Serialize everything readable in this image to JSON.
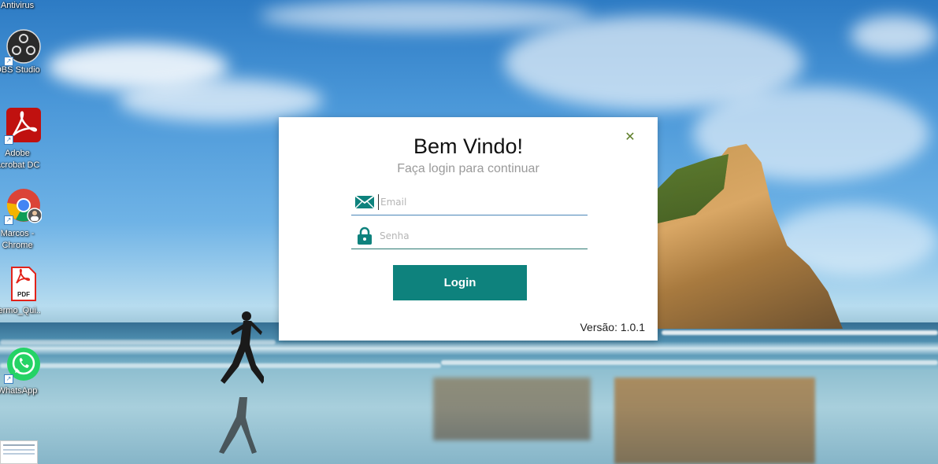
{
  "desktop": {
    "icons": [
      {
        "label": "Antivirus",
        "icon": "antivirus-icon"
      },
      {
        "label": "OBS Studio",
        "icon": "obs-studio-icon"
      },
      {
        "label": "Adobe Acrobat DC",
        "label_line1": "Adobe",
        "label_line2": "Acrobat DC",
        "icon": "adobe-acrobat-icon"
      },
      {
        "label": "Marcos - Chrome",
        "label_line1": "Marcos -",
        "label_line2": "Chrome",
        "icon": "chrome-icon"
      },
      {
        "label": "Termo_Qui...",
        "icon": "pdf-file-icon",
        "badge": "PDF"
      },
      {
        "label": "WhatsApp",
        "icon": "whatsapp-icon"
      }
    ]
  },
  "dialog": {
    "title": "Bem Vindo!",
    "subtitle": "Faça login para continuar",
    "close_icon": "close-icon",
    "email": {
      "placeholder": "Email",
      "value": "",
      "icon": "envelope-icon"
    },
    "password": {
      "placeholder": "Senha",
      "value": "",
      "icon": "lock-icon"
    },
    "login_label": "Login",
    "version": "Versão: 1.0.1"
  },
  "colors": {
    "accent": "#0e827d",
    "field_underline": "#2c7a73",
    "email_underline_focused": "#4a86b8",
    "close_icon": "#5f7f2a"
  }
}
